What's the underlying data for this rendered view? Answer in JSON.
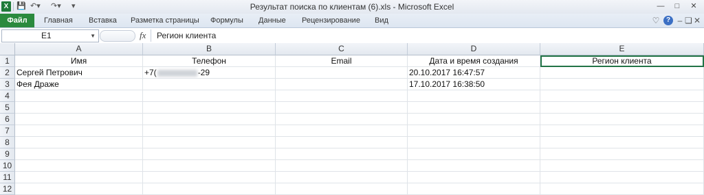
{
  "window": {
    "title": "Результат поиска по клиентам (6).xls  -  Microsoft Excel",
    "app_icon_letter": "X"
  },
  "quick_access": {
    "save_icon": "save-icon",
    "undo_icon": "undo-icon",
    "redo_icon": "redo-icon"
  },
  "ribbon": {
    "file": "Файл",
    "tabs": [
      "Главная",
      "Вставка",
      "Разметка страницы",
      "Формулы",
      "Данные",
      "Рецензирование",
      "Вид"
    ]
  },
  "formula_bar": {
    "name_box": "E1",
    "fx_label": "fx",
    "value": "Регион клиента"
  },
  "sheet": {
    "columns": [
      "A",
      "B",
      "C",
      "D",
      "E"
    ],
    "rows": [
      "1",
      "2",
      "3",
      "4",
      "5",
      "6",
      "7",
      "8",
      "9",
      "10",
      "11",
      "12"
    ],
    "header_row": [
      "Имя",
      "Телефон",
      "Email",
      "Дата и время создания",
      "Регион клиента"
    ],
    "data": [
      {
        "name": "Сергей Петрович",
        "phone_prefix": "+7(",
        "phone_suffix": "-29",
        "email": "",
        "created": "20.10.2017 16:47:57",
        "region": ""
      },
      {
        "name": "Фея Драже",
        "phone_prefix": "",
        "phone_suffix": "",
        "email": "",
        "created": "17.10.2017 16:38:50",
        "region": ""
      }
    ]
  },
  "colors": {
    "file_tab": "#2a8a3e",
    "selection": "#217346"
  }
}
